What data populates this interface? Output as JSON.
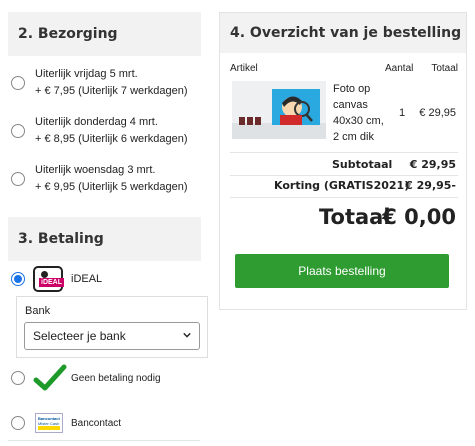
{
  "delivery": {
    "title": "2. Bezorging",
    "options": [
      {
        "line1": "Uiterlijk vrijdag 5 mrt.",
        "line2": "+ € 7,95 (Uiterlijk 7 werkdagen)"
      },
      {
        "line1": "Uiterlijk donderdag 4 mrt.",
        "line2": "+ € 8,95 (Uiterlijk 6 werkdagen)"
      },
      {
        "line1": "Uiterlijk woensdag 3 mrt.",
        "line2": "+ € 9,95 (Uiterlijk 5 werkdagen)"
      }
    ]
  },
  "payment": {
    "title": "3. Betaling",
    "ideal": {
      "label": "iDEAL",
      "logo_text": "iDEAL",
      "selected": true
    },
    "bank": {
      "label": "Bank",
      "select_value": "Selecteer je bank"
    },
    "none": {
      "label": "Geen betaling nodig",
      "icon": "green-checkmark-icon"
    },
    "bancontact": {
      "label": "Bancontact",
      "logo_line1": "Bancontact",
      "logo_line2": "Mister Cash"
    }
  },
  "order": {
    "title": "4. Overzicht van je bestelling",
    "columns": {
      "article": "Artikel",
      "quantity": "Aantal",
      "total": "Totaal"
    },
    "item": {
      "name_lines": [
        "Foto op",
        "canvas",
        "40x30 cm,",
        "2 cm dik"
      ],
      "quantity": "1",
      "price": "€ 29,95"
    },
    "subtotal": {
      "label": "Subtotaal",
      "value": "€ 29,95"
    },
    "discount": {
      "label": "Korting (GRATIS2021)",
      "value": "€ 29,95-"
    },
    "total": {
      "label": "Totaal",
      "value": "€ 0,00"
    },
    "button": "Plaats bestelling"
  },
  "colors": {
    "accent_green": "#2e9c30",
    "radio_blue": "#1a73e8",
    "header_bg": "#f2f2f2"
  }
}
